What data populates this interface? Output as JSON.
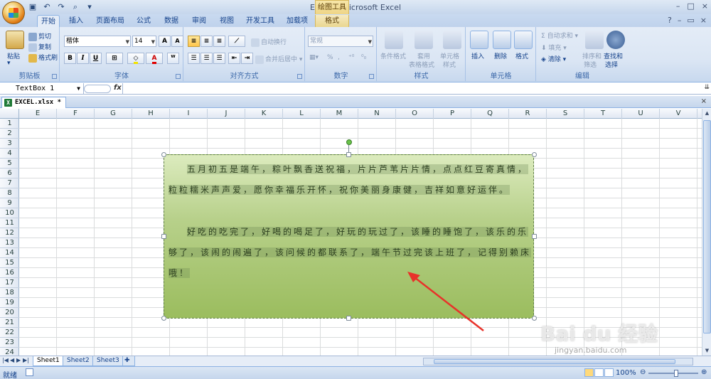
{
  "window": {
    "title": "EXCEL - Microsoft Excel",
    "context_tab_title": "绘图工具",
    "controls": [
      "–",
      "□",
      "×"
    ]
  },
  "tabs": [
    "开始",
    "插入",
    "页面布局",
    "公式",
    "数据",
    "审阅",
    "视图",
    "开发工具",
    "加载项",
    "格式"
  ],
  "ribbon": {
    "clipboard": {
      "paste": "粘贴",
      "cut": "剪切",
      "copy": "复制",
      "format_painter": "格式刷",
      "label": "剪贴板"
    },
    "font": {
      "name": "楷体",
      "size": "14",
      "grow": "A",
      "shrink": "A",
      "bold": "B",
      "italic": "I",
      "underline": "U",
      "label": "字体"
    },
    "alignment": {
      "wrap": "自动换行",
      "merge": "合并后居中",
      "label": "对齐方式"
    },
    "number": {
      "format": "常规",
      "percent": "%",
      "label": "数字"
    },
    "styles": {
      "conditional": "条件格式",
      "table_format": "套用\n表格格式",
      "table_format_1": "套用",
      "table_format_2": "表格格式",
      "cell_style_1": "单元格",
      "cell_style_2": "样式",
      "label": "样式"
    },
    "cells": {
      "insert": "插入",
      "delete": "删除",
      "format": "格式",
      "label": "单元格"
    },
    "editing": {
      "autosum": "自动求和",
      "fill": "填充",
      "clear": "清除",
      "sort_1": "排序和",
      "sort_2": "筛选",
      "find_1": "查找和",
      "find_2": "选择",
      "label": "编辑"
    }
  },
  "formula_bar": {
    "name_box": "TextBox 1",
    "fx": "fx"
  },
  "workbook_tab": "EXCEL.xlsx *",
  "columns": [
    "E",
    "F",
    "G",
    "H",
    "I",
    "J",
    "K",
    "L",
    "M",
    "N",
    "O",
    "P",
    "Q",
    "R",
    "S",
    "T",
    "U",
    "V"
  ],
  "rows": [
    "1",
    "2",
    "3",
    "4",
    "5",
    "6",
    "7",
    "8",
    "9",
    "10",
    "11",
    "12",
    "13",
    "14",
    "15",
    "16",
    "17",
    "18",
    "19",
    "20",
    "21",
    "22",
    "23",
    "24"
  ],
  "textbox": {
    "paragraph1": "五月初五是端午，粽叶飘香送祝福，片片芦苇片片情，点点红豆寄真情，粒粒糯米声声爱，愿你幸福乐开怀，祝你美丽身康健，吉祥如意好运伴。",
    "paragraph2": "好吃的吃完了，好喝的喝足了，好玩的玩过了，该睡的睡饱了，该乐的乐够了，该闹的闹遍了，该问候的都联系了，端午节过完该上班了，记得别赖床哦！"
  },
  "sheets": [
    "Sheet1",
    "Sheet2",
    "Sheet3"
  ],
  "status": {
    "ready": "就绪",
    "zoom": "100%"
  },
  "watermark": {
    "logo": "Bai du 经验",
    "url": "jingyan.baidu.com"
  }
}
